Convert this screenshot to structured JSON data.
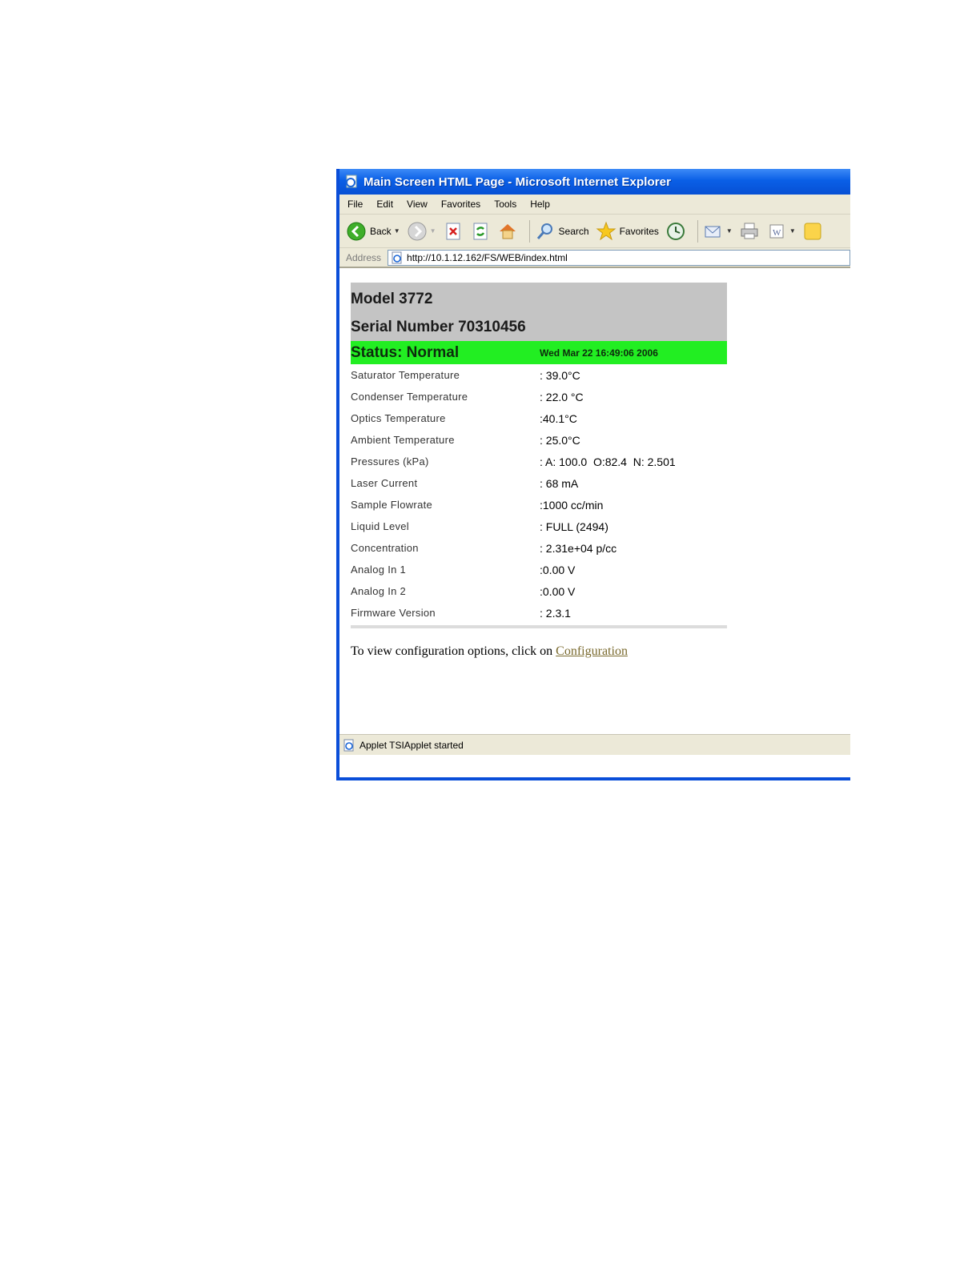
{
  "window": {
    "title": "Main Screen HTML Page - Microsoft Internet Explorer"
  },
  "menu": [
    "File",
    "Edit",
    "View",
    "Favorites",
    "Tools",
    "Help"
  ],
  "toolbar": {
    "back": "Back",
    "search": "Search",
    "favorites": "Favorites"
  },
  "address": {
    "label": "Address",
    "url": "http://10.1.12.162/FS/WEB/index.html"
  },
  "device": {
    "model": "Model 3772",
    "serial": "Serial Number 70310456",
    "status": "Status: Normal",
    "datetime": "Wed Mar 22 16:49:06 2006"
  },
  "params": [
    {
      "label": "Saturator Temperature",
      "value": ": 39.0°C"
    },
    {
      "label": "Condenser Temperature",
      "value": ": 22.0 °C"
    },
    {
      "label": "Optics Temperature",
      "value": ":40.1°C"
    },
    {
      "label": "Ambient Temperature",
      "value": ": 25.0°C"
    },
    {
      "label": "Pressures (kPa)",
      "value": ": A: 100.0  O:82.4  N: 2.501"
    },
    {
      "label": "Laser Current",
      "value": ": 68 mA"
    },
    {
      "label": "Sample Flowrate",
      "value": ":1000 cc/min"
    },
    {
      "label": "Liquid Level",
      "value": ": FULL (2494)"
    },
    {
      "label": "Concentration",
      "value": ": 2.31e+04 p/cc"
    },
    {
      "label": "Analog In 1",
      "value": ":0.00 V"
    },
    {
      "label": "Analog In 2",
      "value": ":0.00 V"
    },
    {
      "label": "Firmware Version",
      "value": ": 2.3.1"
    }
  ],
  "footer": {
    "text": "To view configuration options, click on ",
    "link": "Configuration"
  },
  "statusbar": {
    "text": "Applet TSIApplet started"
  },
  "colors": {
    "status_green": "#22ee22",
    "header_gray": "#c4c4c4",
    "titlebar_blue": "#0a5fe6"
  }
}
